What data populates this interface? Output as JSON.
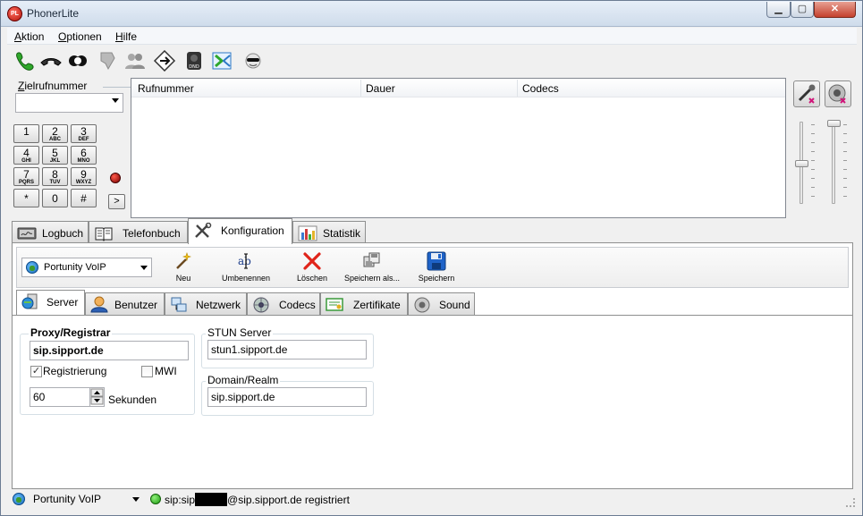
{
  "window": {
    "title": "PhonerLite",
    "icon_label": "PL",
    "controls": {
      "minimize": "▁",
      "maximize": "▢",
      "close": "✕"
    }
  },
  "menu": {
    "items": [
      {
        "first": "A",
        "rest": "ktion"
      },
      {
        "first": "O",
        "rest": "ptionen"
      },
      {
        "first": "H",
        "rest": "ilfe"
      }
    ]
  },
  "toolbar_icons": [
    "phone-call-icon",
    "hangup-icon",
    "hold-icon",
    "transfer-icon",
    "conference-icon",
    "forward-icon",
    "dnd-icon",
    "callback-icon",
    "anonymous-icon"
  ],
  "dial": {
    "label_prefix": "Z",
    "label_rest": "ielrufnummer",
    "value": ""
  },
  "keypad": [
    {
      "d": "1",
      "s": ""
    },
    {
      "d": "2",
      "s": "ABC"
    },
    {
      "d": "3",
      "s": "DEF"
    },
    {
      "d": "4",
      "s": "GHI"
    },
    {
      "d": "5",
      "s": "JKL"
    },
    {
      "d": "6",
      "s": "MNO"
    },
    {
      "d": "7",
      "s": "PQRS"
    },
    {
      "d": "8",
      "s": "TUV"
    },
    {
      "d": "9",
      "s": "WXYZ"
    },
    {
      "d": "*",
      "s": ""
    },
    {
      "d": "0",
      "s": ""
    },
    {
      "d": "#",
      "s": ""
    }
  ],
  "more_button": ">",
  "calllist": {
    "columns": [
      "Rufnummer",
      "Dauer",
      "Codecs"
    ]
  },
  "tabs": [
    {
      "label": "Logbuch",
      "icon": "logbook-icon"
    },
    {
      "label": "Telefonbuch",
      "icon": "phonebook-icon"
    },
    {
      "label": "Konfiguration",
      "icon": "tools-icon",
      "active": true
    },
    {
      "label": "Statistik",
      "icon": "chart-icon"
    }
  ],
  "config": {
    "provider": "Portunity VoIP",
    "buttons": [
      {
        "label": "Neu",
        "icon": "wand-icon"
      },
      {
        "label": "Umbenennen",
        "icon": "rename-icon"
      },
      {
        "label": "Löschen",
        "icon": "delete-icon"
      },
      {
        "label": "Speichern als...",
        "icon": "save-as-icon"
      },
      {
        "label": "Speichern",
        "icon": "save-icon"
      }
    ],
    "subtabs": [
      {
        "label": "Server",
        "icon": "server-icon",
        "active": true
      },
      {
        "label": "Benutzer",
        "icon": "user-icon"
      },
      {
        "label": "Netzwerk",
        "icon": "network-icon"
      },
      {
        "label": "Codecs",
        "icon": "codecs-icon"
      },
      {
        "label": "Zertifikate",
        "icon": "certificate-icon"
      },
      {
        "label": "Sound",
        "icon": "sound-icon"
      }
    ],
    "server": {
      "proxy_title": "Proxy/Registrar",
      "proxy_value": "sip.sipport.de",
      "registration_label": "Registrierung",
      "registration_checked": true,
      "mwi_label": "MWI",
      "mwi_checked": false,
      "interval_value": "60",
      "interval_unit": "Sekunden",
      "stun_title": "STUN Server",
      "stun_value": "stun1.sipport.de",
      "domain_title": "Domain/Realm",
      "domain_value": "sip.sipport.de"
    }
  },
  "statusbar": {
    "provider": "Portunity VoIP",
    "status_prefix": "sip:sip",
    "status_suffix": "@sip.sipport.de registriert"
  },
  "colors": {
    "accent_green": "#1e9c11",
    "led_red": "#b3160b",
    "close_red": "#c4412d"
  }
}
